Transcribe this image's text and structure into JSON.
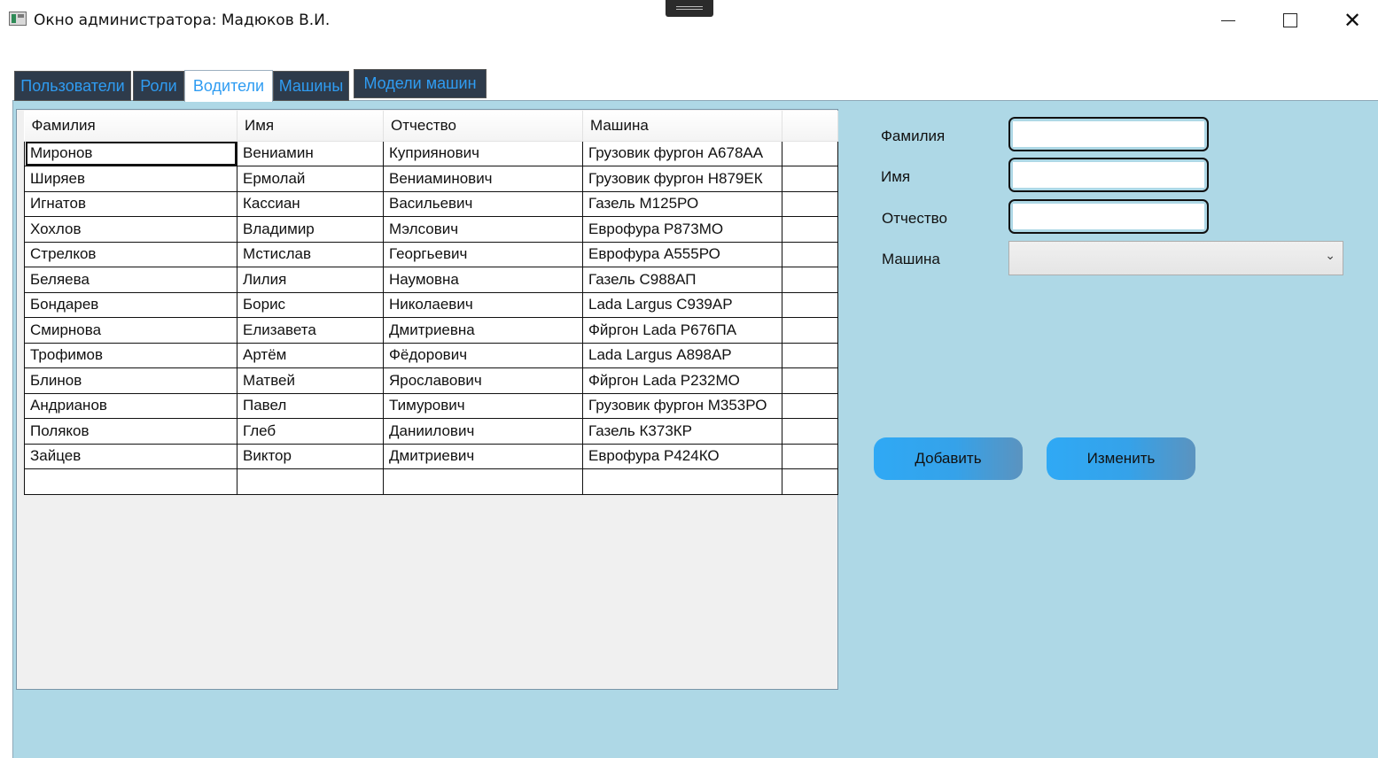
{
  "window": {
    "title": "Окно администратора: Мадюков В.И.",
    "minimize_glyph": "",
    "close_glyph": "✕"
  },
  "tabs": [
    {
      "label": "Пользователи",
      "active": false
    },
    {
      "label": "Роли",
      "active": false
    },
    {
      "label": "Водители",
      "active": true
    },
    {
      "label": "Машины",
      "active": false
    },
    {
      "label": "Модели машин",
      "active": false
    }
  ],
  "grid": {
    "columns": [
      "Фамилия",
      "Имя",
      "Отчество",
      "Машина"
    ],
    "rows": [
      [
        "Миронов",
        "Вениамин",
        "Куприянович",
        "Грузовик фургон А678АА"
      ],
      [
        "Ширяев",
        "Ермолай",
        "Вениаминович",
        "Грузовик фургон Н879ЕК"
      ],
      [
        "Игнатов",
        "Кассиан",
        "Васильевич",
        "Газель М125РО"
      ],
      [
        "Хохлов",
        "Владимир",
        "Мэлсович",
        "Еврофура Р873МО"
      ],
      [
        "Стрелков",
        "Мстислав",
        "Георгьевич",
        "Еврофура А555РО"
      ],
      [
        "Беляева",
        "Лилия",
        "Наумовна",
        "Газель С988АП"
      ],
      [
        "Бондарев",
        "Борис",
        "Николаевич",
        "Lada Largus С939АР"
      ],
      [
        "Смирнова",
        "Елизавета",
        "Дмитриевна",
        "Фйргон Lada Р676ПА"
      ],
      [
        "Трофимов",
        "Артём",
        "Фёдорович",
        "Lada Largus А898АР"
      ],
      [
        "Блинов",
        "Матвей",
        "Ярославович",
        "Фйргон Lada Р232МО"
      ],
      [
        "Андрианов",
        "Павел",
        "Тимурович",
        "Грузовик фургон М353РО"
      ],
      [
        "Поляков",
        "Глеб",
        "Даниилович",
        "Газель К373КР"
      ],
      [
        "Зайцев",
        "Виктор",
        "Дмитриевич",
        "Еврофура Р424КО"
      ]
    ]
  },
  "form": {
    "last_name_label": "Фамилия",
    "last_name_value": "",
    "first_name_label": "Имя",
    "first_name_value": "",
    "patronymic_label": "Отчество",
    "patronymic_value": "",
    "car_label": "Машина",
    "car_value": "",
    "chevron": "⌄"
  },
  "buttons": {
    "add_label": "Добавить",
    "edit_label": "Изменить"
  }
}
